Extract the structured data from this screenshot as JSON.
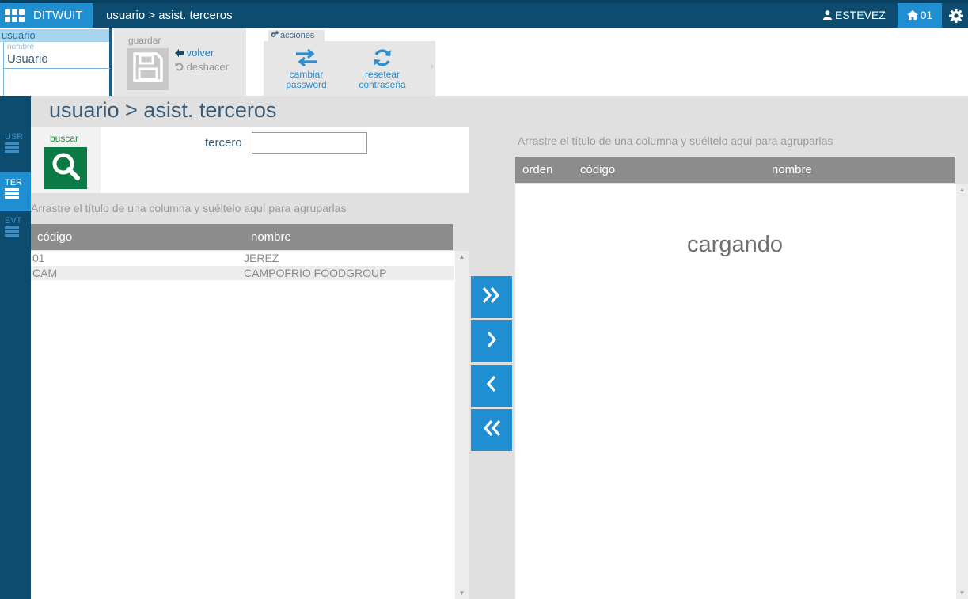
{
  "app": {
    "brand": "DITWUIT",
    "breadcrumb": "usuario > asist. terceros"
  },
  "topbar": {
    "user": "ESTEVEZ",
    "home": "01"
  },
  "record": {
    "entity": "usuario",
    "field_label": "nombre",
    "field_value": "Usuario"
  },
  "toolbar": {
    "group_label": "guardar",
    "back": "volver",
    "undo": "deshacer"
  },
  "actions": {
    "tab_label": "acciones",
    "change_pwd": [
      "cambiar",
      "password"
    ],
    "reset_pwd": [
      "resetear",
      "contraseña"
    ]
  },
  "rail": [
    {
      "code": "USR",
      "active": false
    },
    {
      "code": "TER",
      "active": true
    },
    {
      "code": "EVT",
      "active": false
    }
  ],
  "page": {
    "title": "usuario > asist. terceros"
  },
  "search": {
    "button_label": "buscar",
    "field_label": "tercero",
    "field_value": ""
  },
  "left_grid": {
    "drop_hint": "Arrastre el título de una columna y suéltelo aquí para agruparlas",
    "columns": [
      "código",
      "nombre"
    ],
    "rows": [
      {
        "code": "01",
        "name": "JEREZ"
      },
      {
        "code": "CAM",
        "name": "CAMPOFRIO FOODGROUP"
      }
    ]
  },
  "right_grid": {
    "drop_hint": "Arrastre el título de una columna y suéltelo aquí para agruparlas",
    "columns": [
      "orden",
      "código",
      "nombre"
    ],
    "status": "cargando"
  },
  "colors": {
    "topbar": "#0d4c6e",
    "accent": "#1f8fd1",
    "search_green": "#0c7a44",
    "grid_header": "#8c8c8c"
  }
}
